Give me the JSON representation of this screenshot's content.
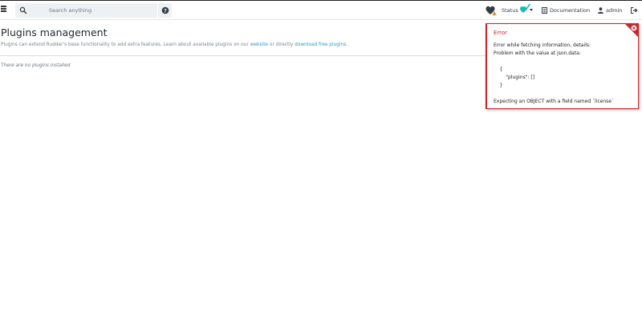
{
  "topbar": {
    "search": {
      "placeholder": "Search anything"
    },
    "status_label": "Status",
    "documentation_label": "Documentation",
    "user_label": "admin"
  },
  "page": {
    "title": "Plugins management",
    "description": {
      "prefix": "Plugins can extend Rudder's base functionality to add extra features. Learn about available plugins on our ",
      "website_link": "website",
      "middle": " or directly ",
      "download_link": "download free plugins",
      "suffix": "."
    },
    "empty_message": "There are no plugins installed"
  },
  "error_toast": {
    "title": "Error",
    "lines": [
      "Error while fetching information, details:",
      "Problem with the value at json.data:",
      "",
      "    {",
      "        \"plugins\": []",
      "    }",
      "",
      "Expecting an OBJECT with a field named `license`"
    ]
  },
  "colors": {
    "error": "#c9262c",
    "link": "#2b9bc6",
    "status_ok": "#13beb7",
    "health_warning": "#f0ad4e"
  },
  "icons": [
    "menu-icon",
    "search-icon",
    "help-icon",
    "health-heart-icon",
    "status-check-icon",
    "documentation-icon",
    "user-icon",
    "logout-icon",
    "close-icon"
  ]
}
